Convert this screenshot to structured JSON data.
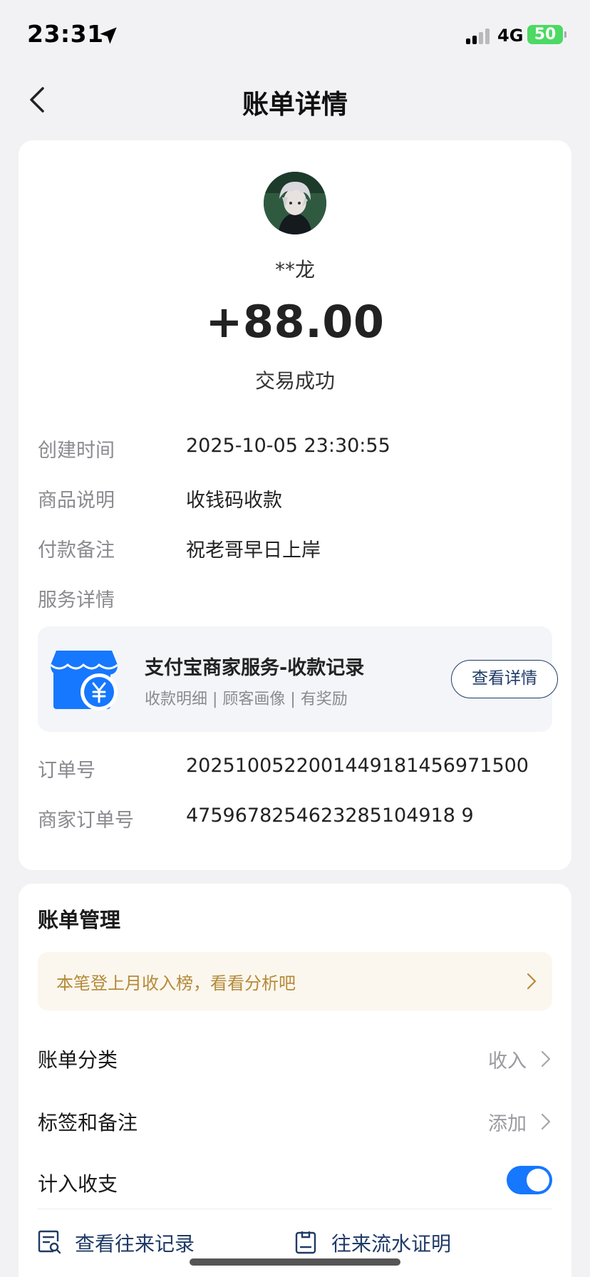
{
  "status_bar": {
    "time": "23:31",
    "network": "4G",
    "battery": "50"
  },
  "header": {
    "title": "账单详情"
  },
  "transaction": {
    "counterparty": "**龙",
    "amount": "+88.00",
    "status": "交易成功"
  },
  "details": {
    "created_label": "创建时间",
    "created_value": "2025-10-05 23:30:55",
    "product_label": "商品说明",
    "product_value": "收钱码收款",
    "remark_label": "付款备注",
    "remark_value": "祝老哥早日上岸",
    "service_label": "服务详情",
    "order_label": "订单号",
    "order_value": "2025100522001449181456971500",
    "merchant_order_label": "商家订单号",
    "merchant_order_value": "4759678254623285104918 9"
  },
  "service": {
    "title": "支付宝商家服务-收款记录",
    "subtitle": "收款明细 | 顾客画像 | 有奖励",
    "button": "查看详情"
  },
  "manage": {
    "title": "账单管理",
    "banner": "本笔登上月收入榜，看看分析吧",
    "category_label": "账单分类",
    "category_value": "收入",
    "tags_label": "标签和备注",
    "tags_value": "添加",
    "include_label": "计入收支",
    "include_enabled": true,
    "link_history": "查看往来记录",
    "link_proof": "往来流水证明"
  },
  "colors": {
    "accent": "#1677ff",
    "link": "#1f3a66",
    "banner_text": "#b58a3a"
  }
}
